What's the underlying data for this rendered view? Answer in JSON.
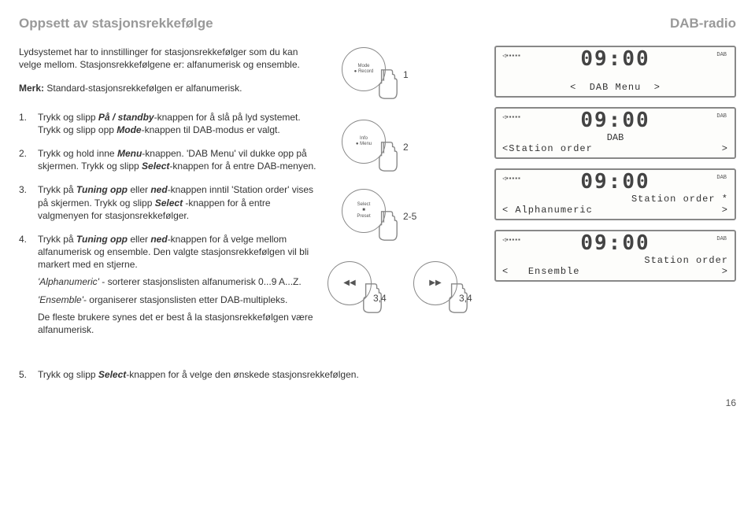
{
  "header": {
    "title_left": "Oppsett av stasjonsrekkefølge",
    "title_right": "DAB-radio"
  },
  "intro": "Lydsystemet har to innstillinger for stasjonsrekkefølger som du kan velge mellom. Stasjonsrekkefølgene er: alfanumerisk og ensemble.",
  "merk_label": "Merk:",
  "merk_text": " Standard-stasjonsrekkefølgen er alfanumerisk.",
  "steps": [
    {
      "n": "1.",
      "text_a": "Trykk og slipp ",
      "em1": "På / standby",
      "text_b": "-knappen for å slå på lyd systemet. Trykk og slipp opp ",
      "em2": "Mode",
      "text_c": "-knappen til DAB-modus er valgt."
    },
    {
      "n": "2.",
      "text_a": "Trykk og hold inne ",
      "em1": "Menu",
      "text_b": "-knappen. 'DAB Menu' vil dukke opp på skjermen. Trykk og slipp ",
      "em2": "Select",
      "text_c": "-knappen for å entre DAB-menyen."
    },
    {
      "n": "3.",
      "text_a": "Trykk på ",
      "em1": "Tuning opp",
      "text_b": " eller ",
      "em2": "ned",
      "text_c": "-knappen inntil 'Station order' vises på skjermen. Trykk og slipp ",
      "em3": "Select",
      "text_d": " -knappen for å entre valgmenyen for stasjonsrekkefølger."
    },
    {
      "n": "4.",
      "text_a": "Trykk på ",
      "em1": "Tuning opp",
      "text_b": " eller ",
      "em2": "ned",
      "text_c": "-knappen for å velge mellom alfanumerisk og ensemble. Den valgte stasjonsrekkefølgen vil bli markert med en stjerne.",
      "sub1_em": "'Alphanumeric'",
      "sub1": " - sorterer stasjonslisten alfanumerisk 0...9 A...Z.",
      "sub2_em": "'Ensemble'",
      "sub2": "- organiserer stasjonslisten etter DAB-multipleks.",
      "sub3": "De fleste brukere synes det er best å la stasjonsrekkefølgen være alfanumerisk."
    }
  ],
  "step5": {
    "n": "5.",
    "text_a": "Trykk og slipp ",
    "em1": "Select",
    "text_b": "-knappen for å velge den ønskede stasjonsrekkefølgen."
  },
  "buttons": {
    "b1": {
      "l1": "Mode",
      "l2": "● Record",
      "tag": "1"
    },
    "b2": {
      "l1": "Info",
      "l2": "● Menu",
      "tag": "2"
    },
    "b3": {
      "l1": "Select",
      "l2": "■",
      "l3": "Preset",
      "tag": "2-5"
    },
    "b4a": {
      "icon": "◀◀",
      "tag": "3,4"
    },
    "b4b": {
      "icon": "▶▶",
      "tag": "3,4"
    }
  },
  "lcds": [
    {
      "time": "09:00",
      "dab": "DAB",
      "line3_l": "<",
      "line3": "DAB Menu",
      "line3_r": ">"
    },
    {
      "time": "09:00",
      "dab": "DAB",
      "line2": "DAB",
      "line3_l": "<",
      "line3": "Station order",
      "line3_r": ">"
    },
    {
      "time": "09:00",
      "dab": "DAB",
      "line2": "Station order *",
      "line3_l": "<",
      "line3": "Alphanumeric",
      "line3_r": ">"
    },
    {
      "time": "09:00",
      "dab": "DAB",
      "line2": "Station order",
      "line3_l": "<",
      "line3": "Ensemble",
      "line3_r": ">"
    }
  ],
  "signal": "◁▪▪▪▪▪",
  "page": "16"
}
